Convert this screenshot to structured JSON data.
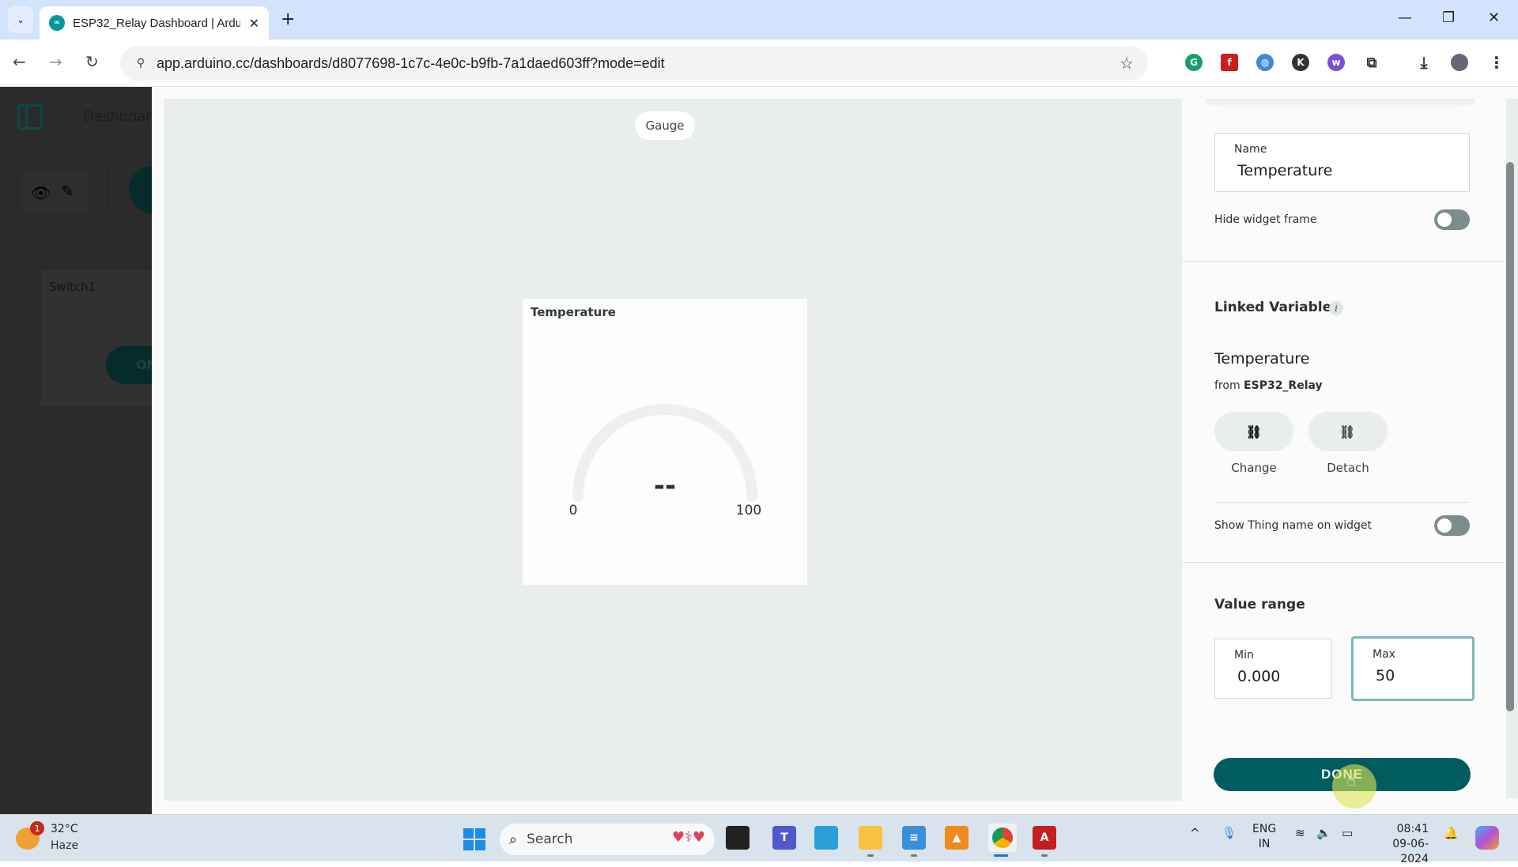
{
  "browser": {
    "tab_title": "ESP32_Relay Dashboard | Arduino",
    "url": "app.arduino.cc/dashboards/d8077698-1c7c-4e0c-b9fb-7a1daed603ff?mode=edit",
    "icons": {
      "tab_search": "chevron-down-icon",
      "favicon": "arduino-icon",
      "close": "close-icon",
      "new_tab": "plus-icon",
      "back": "arrow-left-icon",
      "forward": "arrow-right-icon",
      "reload": "reload-icon",
      "site_info": "tune-icon",
      "bookmark": "star-icon",
      "extensions": [
        "grammarly-icon",
        "flash-icon",
        "globe-icon",
        "k-extension-icon",
        "w-extension-icon",
        "puzzle-icon"
      ],
      "download": "download-icon",
      "menu": "kebab-menu-icon"
    },
    "glyphs": {
      "tab_search": "⌄",
      "favicon": "∞",
      "close": "✕",
      "new_tab": "+",
      "minimize": "—",
      "restore": "❐",
      "window_close": "✕",
      "back": "←",
      "forward": "→",
      "reload": "↻",
      "site_info": "⚲",
      "star": "☆",
      "download": "⤓",
      "menu": "⋮"
    }
  },
  "dashboard": {
    "title": "Dashboard",
    "mode_view_glyph": "👁",
    "mode_edit_glyph": "✎",
    "switch_widget": {
      "title": "Switch1",
      "button_label": "ON"
    }
  },
  "canvas": {
    "widget_type": "Gauge",
    "gauge": {
      "title": "Temperature",
      "value_display": "--",
      "min_label": "0",
      "max_label": "100",
      "min": 0,
      "max": 100,
      "value": null
    }
  },
  "panel": {
    "name_label": "Name",
    "name_value": "Temperature",
    "hide_frame_label": "Hide widget frame",
    "hide_frame_on": false,
    "linked_variable_heading": "Linked Variable",
    "info_glyph": "i",
    "variable_name": "Temperature",
    "from_prefix": "from",
    "thing_name": "ESP32_Relay",
    "change_label": "Change",
    "detach_label": "Detach",
    "change_glyph": "⛓",
    "detach_glyph": "⛓",
    "show_thing_label": "Show Thing name on widget",
    "show_thing_on": false,
    "value_range_heading": "Value range",
    "min_label": "Min",
    "min_value": "0.000",
    "max_label": "Max",
    "max_value": "50",
    "done_label": "DONE"
  },
  "taskbar": {
    "weather_temp": "32°C",
    "weather_desc": "Haze",
    "weather_badge": "1",
    "search_placeholder": "Search",
    "search_glyph": "⌕",
    "search_deco": "♥⚕♥",
    "tray_chevron": "^",
    "mic_glyph": "🎙",
    "lang_line1": "ENG",
    "lang_line2": "IN",
    "wifi_glyph": "≋",
    "volume_glyph": "🔈",
    "battery_glyph": "▭",
    "time": "08:41",
    "date": "09-06-2024",
    "bell_glyph": "🔔",
    "apps": [
      "task-view",
      "teams",
      "remote-desktop",
      "file-explorer",
      "notepad",
      "vlc",
      "chrome",
      "acrobat"
    ]
  },
  "colors": {
    "accent": "#005c5f",
    "toggle_off": "#7d8c8c",
    "focus_border": "#7fb8b8",
    "canvas_bg": "#e9eded"
  }
}
